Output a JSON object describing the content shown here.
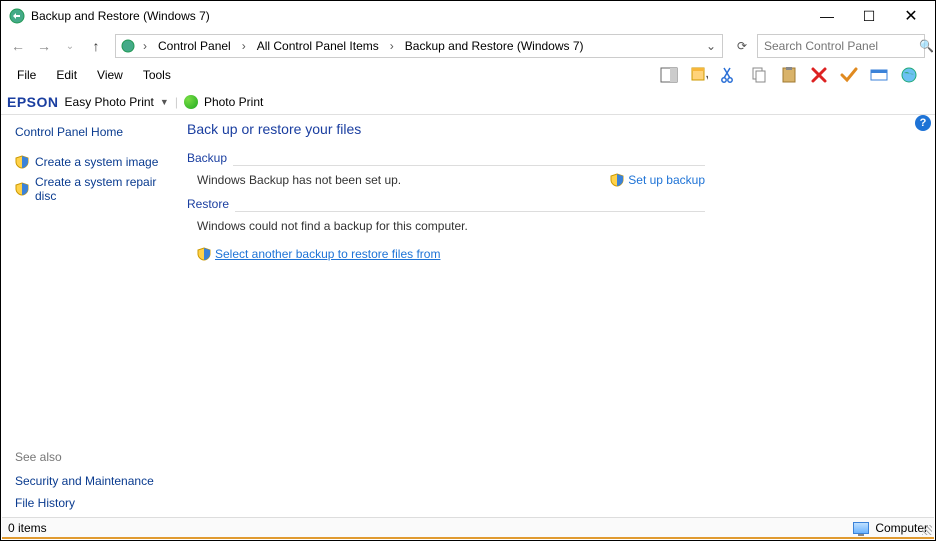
{
  "window": {
    "title": "Backup and Restore (Windows 7)"
  },
  "breadcrumb": {
    "items": [
      "Control Panel",
      "All Control Panel Items",
      "Backup and Restore (Windows 7)"
    ]
  },
  "search": {
    "placeholder": "Search Control Panel"
  },
  "menu": {
    "file": "File",
    "edit": "Edit",
    "view": "View",
    "tools": "Tools"
  },
  "epson": {
    "brand": "EPSON",
    "easy": "Easy Photo Print",
    "photo": "Photo Print"
  },
  "sidebar": {
    "home": "Control Panel Home",
    "create_image": "Create a system image",
    "create_disc": "Create a system repair disc",
    "see_also": "See also",
    "security": "Security and Maintenance",
    "file_history": "File History"
  },
  "main": {
    "heading": "Back up or restore your files",
    "backup_title": "Backup",
    "backup_text": "Windows Backup has not been set up.",
    "setup_link": "Set up backup",
    "restore_title": "Restore",
    "restore_text": "Windows could not find a backup for this computer.",
    "restore_link": "Select another backup to restore files from"
  },
  "status": {
    "items": "0 items",
    "computer": "Computer"
  }
}
